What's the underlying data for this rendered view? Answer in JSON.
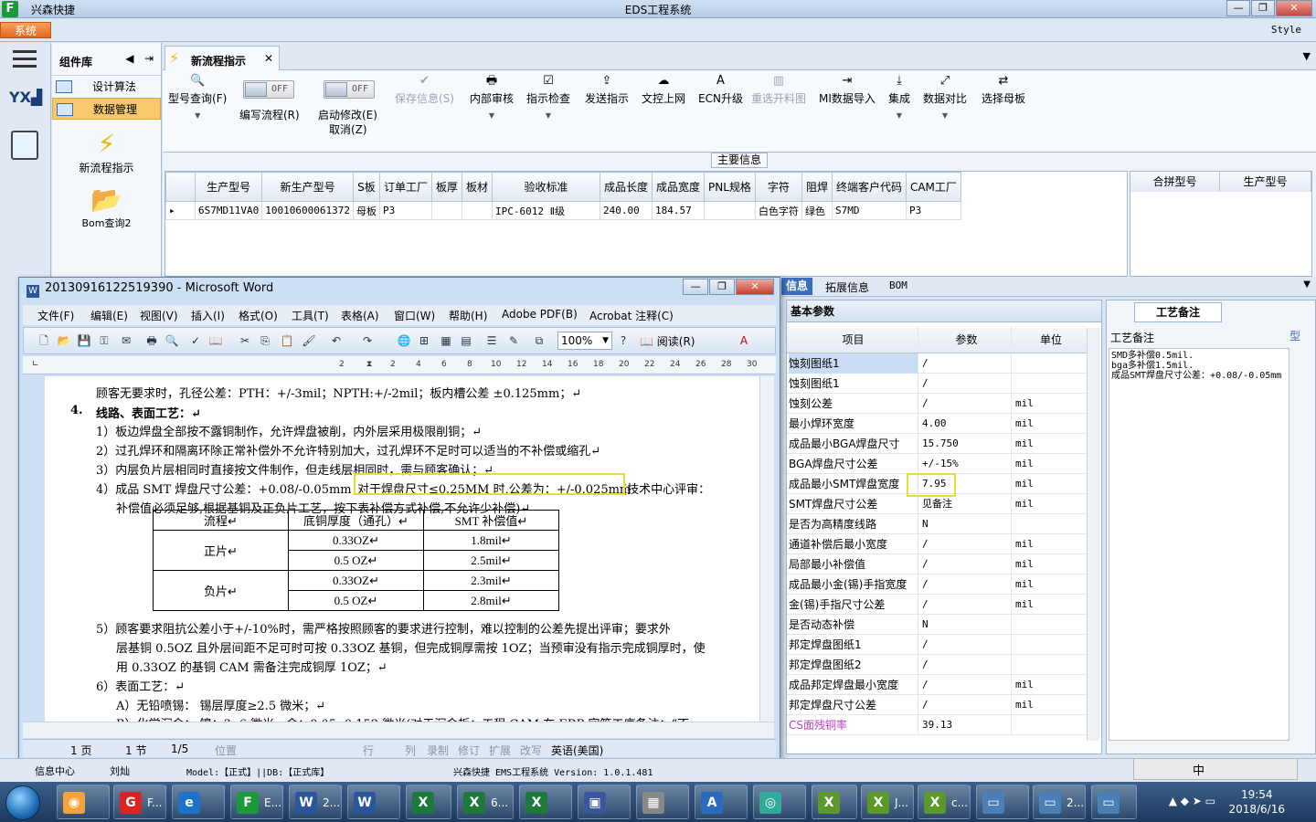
{
  "app": {
    "brand": "兴森快捷",
    "title": "EDS工程系统",
    "menu_system": "系统",
    "style": "Style"
  },
  "winbtns": [
    "—",
    "❐",
    "✕"
  ],
  "sidebar": {
    "panel_title": "组件库",
    "items": [
      {
        "label": "设计算法"
      },
      {
        "label": "数据管理"
      }
    ],
    "big_items": [
      {
        "label": "新流程指示"
      },
      {
        "label": "Bom查询2"
      }
    ]
  },
  "tab": {
    "label": "新流程指示"
  },
  "ribbon": {
    "items": [
      {
        "label": "型号查询(F)",
        "icon": "🔍"
      },
      {
        "label": "编写流程(R)",
        "toggle": "OFF"
      },
      {
        "label": "启动修改(E)",
        "sub": "取消(Z)",
        "toggle": "OFF"
      },
      {
        "label": "保存信息(S)",
        "icon": "✔",
        "disabled": true
      },
      {
        "label": "内部审核",
        "icon": "🖶"
      },
      {
        "label": "指示检查",
        "icon": "☑"
      },
      {
        "label": "发送指示",
        "icon": "⇪"
      },
      {
        "label": "文控上网",
        "icon": "☁"
      },
      {
        "label": "ECN升级",
        "icon": "A"
      },
      {
        "label": "重选开料图",
        "icon": "▥",
        "disabled": true
      },
      {
        "label": "MI数据导入",
        "icon": "⇥"
      },
      {
        "label": "集成",
        "icon": "⤓"
      },
      {
        "label": "数据对比",
        "icon": "⤢"
      },
      {
        "label": "选择母板",
        "icon": "⇄"
      }
    ]
  },
  "main_info": {
    "label": "主要信息",
    "columns": [
      "生产型号",
      "新生产型号",
      "S板",
      "订单工厂",
      "板厚",
      "板材",
      "验收标准",
      "成品长度",
      "成品宽度",
      "PNL规格",
      "字符",
      "阻焊",
      "终端客户代码",
      "CAM工厂"
    ],
    "row": [
      "6S7MD11VA0",
      "10010600061372",
      "母板",
      "P3",
      "",
      "",
      "IPC-6012 Ⅱ级",
      "240.00",
      "184.57",
      "",
      "白色字符",
      "绿色",
      "S7MD",
      "P3"
    ],
    "side_columns": [
      "合拼型号",
      "生产型号"
    ]
  },
  "info_tabs": [
    "信息",
    "拓展信息",
    "BOM"
  ],
  "params": {
    "title": "基本参数",
    "headers": [
      "项目",
      "参数",
      "单位"
    ],
    "rows": [
      [
        "蚀刻图纸1",
        "/",
        ""
      ],
      [
        "蚀刻图纸1",
        "/",
        ""
      ],
      [
        "蚀刻公差",
        "/",
        "mil"
      ],
      [
        "最小焊环宽度",
        "4.00",
        "mil"
      ],
      [
        "成品最小BGA焊盘尺寸",
        "15.750",
        "mil"
      ],
      [
        "BGA焊盘尺寸公差",
        "+/-15%",
        "mil"
      ],
      [
        "成品最小SMT焊盘宽度",
        "7.95",
        "mil"
      ],
      [
        "SMT焊盘尺寸公差",
        "见备注",
        "mil"
      ],
      [
        "是否为高精度线路",
        "N",
        ""
      ],
      [
        "通道补偿后最小宽度",
        "/",
        "mil"
      ],
      [
        "局部最小补偿值",
        "/",
        "mil"
      ],
      [
        "成品最小金(锡)手指宽度",
        "/",
        "mil"
      ],
      [
        "金(锡)手指尺寸公差",
        "/",
        "mil"
      ],
      [
        "是否动态补偿",
        "N",
        ""
      ],
      [
        "邦定焊盘图纸1",
        "/",
        ""
      ],
      [
        "邦定焊盘图纸2",
        "/",
        ""
      ],
      [
        "成品邦定焊盘最小宽度",
        "/",
        "mil"
      ],
      [
        "邦定焊盘尺寸公差",
        "/",
        "mil"
      ],
      [
        "CS面残铜率",
        "39.13",
        ""
      ]
    ]
  },
  "craft": {
    "tab": "工艺备注",
    "label": "工艺备注",
    "side": "型",
    "text": "SMD多补偿0.5mil.\nbga多补偿1.5mil.\n成品SMT焊盘尺寸公差：+0.08/-0.05mm"
  },
  "word": {
    "title": "20130916122519390 - Microsoft Word",
    "menus": [
      "文件(F)",
      "编辑(E)",
      "视图(V)",
      "插入(I)",
      "格式(O)",
      "工具(T)",
      "表格(A)",
      "窗口(W)",
      "帮助(H)",
      "Adobe PDF(B)",
      "Acrobat 注释(C)"
    ],
    "zoom": "100%",
    "read": "阅读(R)",
    "ruler": [
      "2",
      "2",
      "4",
      "6",
      "8",
      "10",
      "12",
      "14",
      "16",
      "18",
      "20",
      "22",
      "24",
      "26",
      "28",
      "30"
    ],
    "lines": [
      "顾客无要求时，孔径公差：PTH：+/-3mil；NPTH:+/-2mil；板内槽公差 ±0.125mm；↵",
      "线路、表面工艺：↵",
      "1）板边焊盘全部按不露铜制作，允许焊盘被削，内外层采用极限削铜；↵",
      "2）过孔焊环和隔离环除正常补偿外不允许特别加大，过孔焊环不足时可以适当的不补偿或缩孔↵",
      "3）内层负片层相同时直接按文件制作，但走线层相同时，需与顾客确认；↵",
      "4）成品 SMT 焊盘尺寸公差：+0.08/-0.05mm；",
      "对于焊盘尺寸≤0.25MM 时,公差为：+/-0.025mm",
      "(技术中心评审：",
      "补偿值必须足够,根据基铜及正负片工艺，按下表补偿方式补偿,不允许少补偿)↵",
      "5）顾客要求阻抗公差小于+/-10%时，需严格按照顾客的要求进行控制，难以控制的公差先提出评审；要求外",
      "层基铜 0.5OZ 且外层间距不足可时可按 0.33OZ 基铜，但完成铜厚需按 1OZ；当预审没有指示完成铜厚时，使",
      "用 0.33OZ 的基铜 CAM 需备注完成铜厚 1OZ；↵",
      "6）表面工艺：↵",
      "A）无铅喷锡： 锡层厚度≥2.5 微米；↵",
      "B）化学沉金： 镍：3--6 微米，金：0.05--0.152 微米(对于沉金板：工程 CAM 在 ERP 字符工序备注：“不"
    ],
    "section_num": "4.",
    "table": {
      "headers": [
        "流程↵",
        "底铜厚度（通孔）↵",
        "SMT 补偿值↵"
      ],
      "groups": [
        {
          "name": "正片↵",
          "rows": [
            [
              "0.33OZ↵",
              "1.8mil↵"
            ],
            [
              "0.5 OZ↵",
              "2.5mil↵"
            ]
          ]
        },
        {
          "name": "负片↵",
          "rows": [
            [
              "0.33OZ↵",
              "2.3mil↵"
            ],
            [
              "0.5 OZ↵",
              "2.8mil↵"
            ]
          ]
        }
      ]
    },
    "status": {
      "page": "1 页",
      "section": "1 节",
      "pages": "1/5",
      "pos": "位置",
      "line": "行",
      "col": "列",
      "rec": "录制",
      "rev": "修订",
      "ext": "扩展",
      "ovr": "改写",
      "lang": "英语(美国)"
    }
  },
  "app_status": {
    "msg_center": "信息中心",
    "user": "刘灿",
    "model": "Model:【正式】||DB:【正式库】",
    "version": "兴森快捷 EMS工程系统 Version: 1.0.1.481"
  },
  "ime": {
    "lang": "中"
  },
  "taskbar": {
    "items": [
      {
        "label": "F..."
      },
      {
        "label": "E..."
      },
      {
        "label": "2..."
      },
      {
        "label": "6..."
      },
      {
        "label": "J..."
      },
      {
        "label": "c..."
      },
      {
        "label": "2..."
      }
    ],
    "time": "19:54",
    "date": "2018/6/16"
  }
}
